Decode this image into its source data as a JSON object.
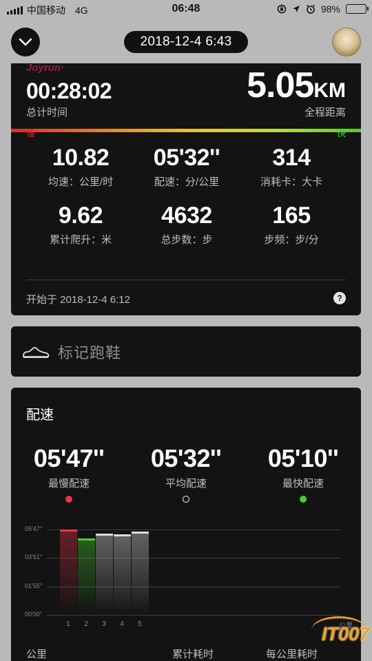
{
  "status_bar": {
    "carrier": "中国移动",
    "network": "4G",
    "time": "06:48",
    "battery": "98%"
  },
  "header": {
    "date": "2018-12-4 6:43"
  },
  "summary": {
    "watermark": "Joyrun·",
    "total_time": "00:28:02",
    "total_time_label": "总计时间",
    "distance_value": "5.05",
    "distance_unit": "KM",
    "distance_label": "全程距离",
    "slow_label": "慢",
    "fast_label": "快",
    "stats": [
      {
        "value": "10.82",
        "label": "均速：公里/时"
      },
      {
        "value": "05'32''",
        "label": "配速：分/公里"
      },
      {
        "value": "314",
        "label": "消耗卡：大卡"
      },
      {
        "value": "9.62",
        "label": "累计爬升：米"
      },
      {
        "value": "4632",
        "label": "总步数：步"
      },
      {
        "value": "165",
        "label": "步频：步/分"
      }
    ],
    "start_text": "开始于 2018-12-4 6:12",
    "help": "?"
  },
  "shoe": {
    "label": "标记跑鞋"
  },
  "pace": {
    "title": "配速",
    "slowest": {
      "value": "05'47''",
      "label": "最慢配速",
      "color": "#e8344a"
    },
    "average": {
      "value": "05'32''",
      "label": "平均配速",
      "color": "#ffffff"
    },
    "fastest": {
      "value": "05'10''",
      "label": "最快配速",
      "color": "#4ad02e"
    },
    "table_headers": [
      "公里",
      "累计耗时",
      "每公里耗时"
    ]
  },
  "chart_data": {
    "type": "bar",
    "categories": [
      "1",
      "2",
      "3",
      "4",
      "5"
    ],
    "values": [
      5.78,
      5.17,
      5.5,
      5.47,
      5.63
    ],
    "y_ticks": [
      "05'47''",
      "03'51''",
      "01'55''",
      "00'00''"
    ],
    "y_tick_values": [
      5.78,
      3.85,
      1.92,
      0
    ],
    "ylim": [
      0,
      5.78
    ],
    "xlabel": "公里",
    "bar_colors": [
      "#e8344a",
      "#4ad02e",
      "#dddddd",
      "#dddddd",
      "#dddddd"
    ]
  },
  "logo": "IT007"
}
